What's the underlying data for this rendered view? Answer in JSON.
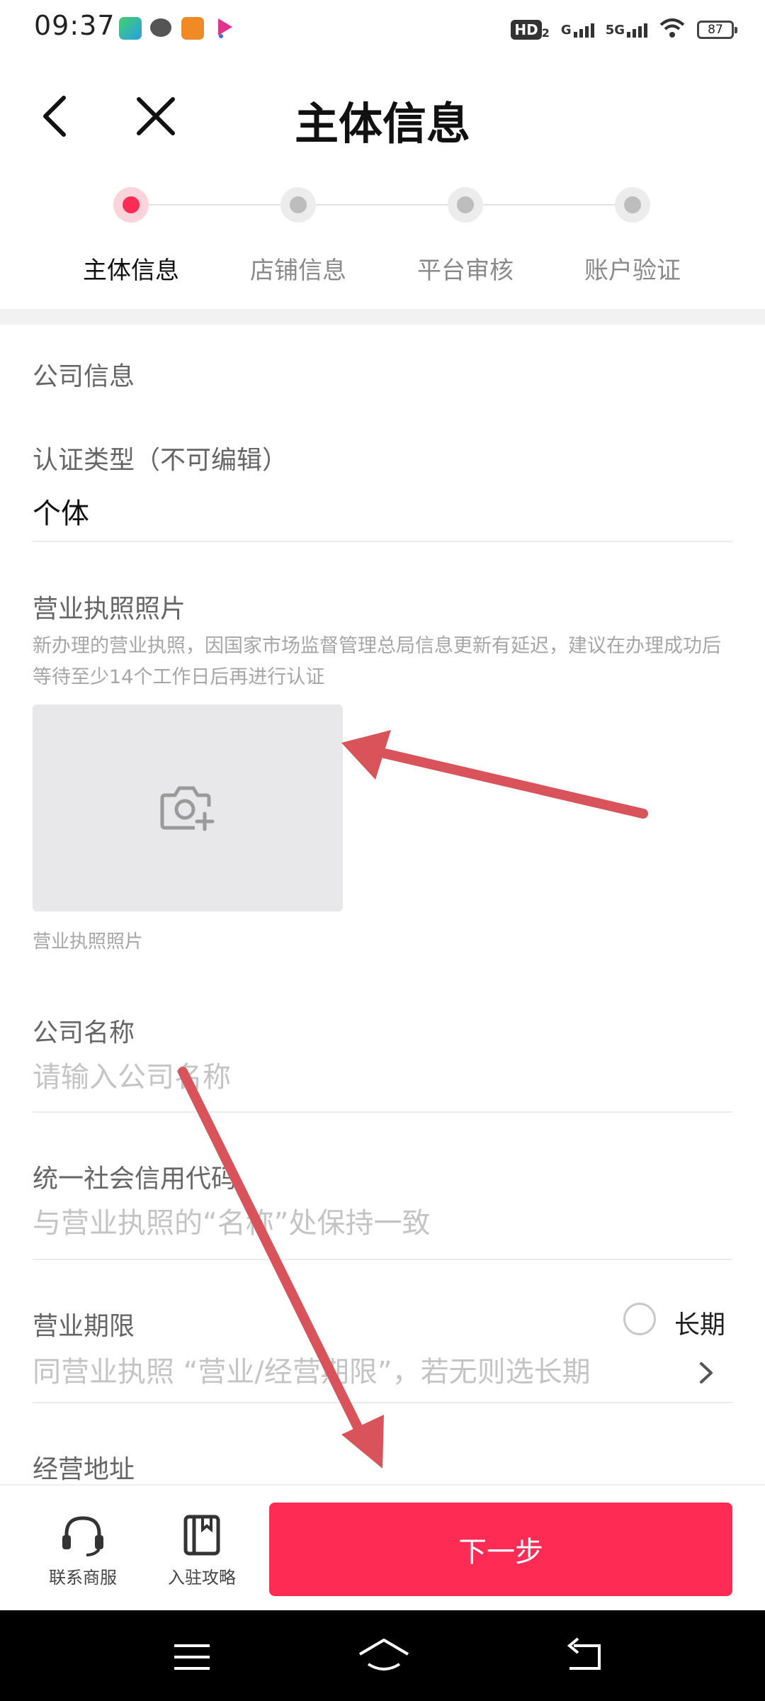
{
  "status_bar": {
    "time": "09:37",
    "hd_badge": "HD",
    "hd_sub": "2",
    "network_1": "G",
    "network_2": "5G",
    "battery": "87"
  },
  "header": {
    "title": "主体信息",
    "back_icon": "chevron-left-icon",
    "close_icon": "close-icon"
  },
  "steps": [
    {
      "label": "主体信息",
      "active": true
    },
    {
      "label": "店铺信息",
      "active": false
    },
    {
      "label": "平台审核",
      "active": false
    },
    {
      "label": "账户验证",
      "active": false
    }
  ],
  "form": {
    "section_title": "公司信息",
    "cert_type": {
      "label": "认证类型（不可编辑）",
      "value": "个体"
    },
    "license": {
      "label": "营业执照照片",
      "hint": "新办理的营业执照，因国家市场监督管理总局信息更新有延迟，建议在办理成功后等待至少14个工作日后再进行认证",
      "caption": "营业执照照片",
      "upload_icon": "camera-plus-icon"
    },
    "company_name": {
      "label": "公司名称",
      "placeholder": "请输入公司名称"
    },
    "credit_code": {
      "label": "统一社会信用代码",
      "placeholder": "与营业执照的“名称”处保持一致"
    },
    "business_term": {
      "label": "营业期限",
      "long_term_label": "长期",
      "placeholder": "同营业执照 “营业/经营期限”，若无则选长期"
    },
    "address": {
      "label": "经营地址"
    }
  },
  "bottom_bar": {
    "contact_label": "联系商服",
    "guide_label": "入驻攻略",
    "next_label": "下一步"
  },
  "colors": {
    "accent": "#fe2c55",
    "annotation_arrow": "#d9535a"
  }
}
